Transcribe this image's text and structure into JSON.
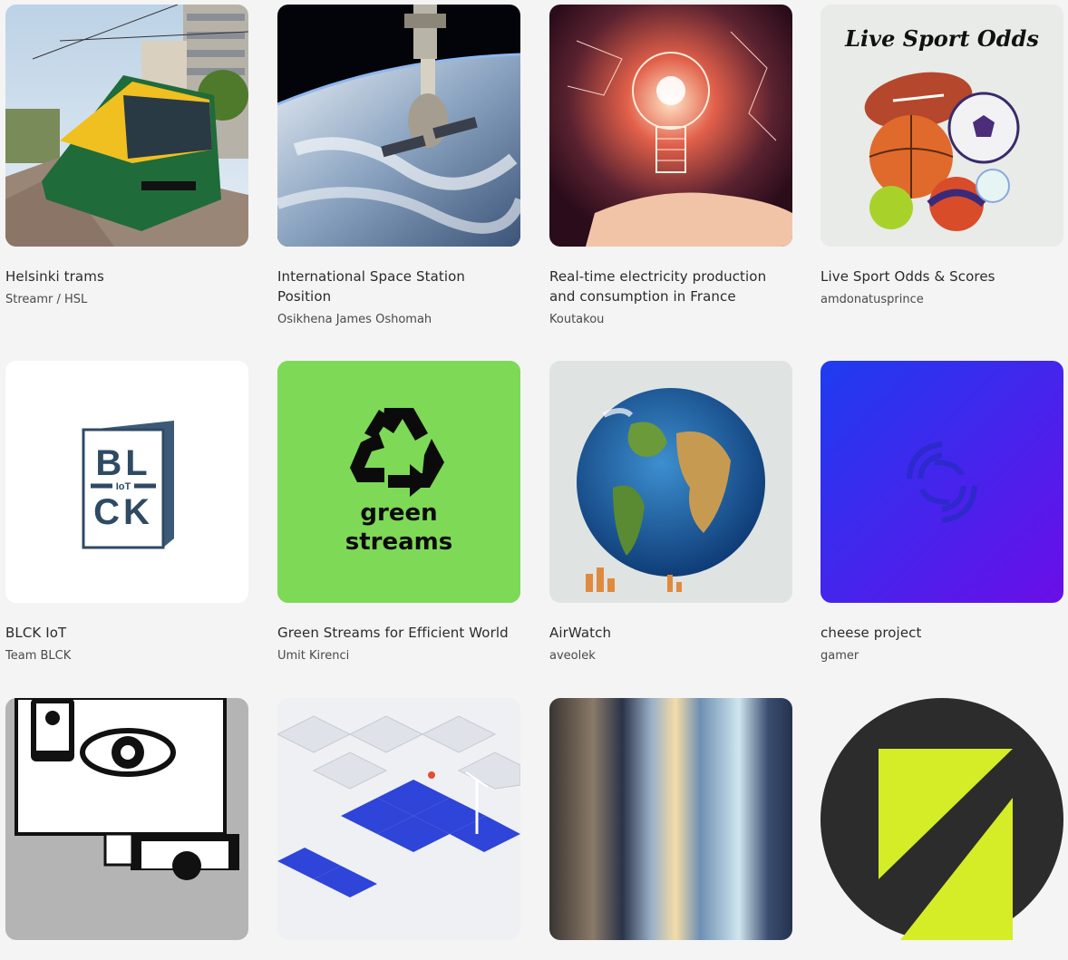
{
  "streams": [
    {
      "title": "Helsinki trams",
      "author": "Streamr / HSL",
      "thumb_icon": "tram-photo"
    },
    {
      "title": "International Space Station Position",
      "author": "Osikhena James Oshomah",
      "thumb_icon": "space-station-photo"
    },
    {
      "title": "Real-time electricity production and consumption in France",
      "author": "Koutakou",
      "thumb_icon": "lightbulb-hand-image"
    },
    {
      "title": "Live Sport Odds & Scores",
      "author": "amdonatusprince",
      "thumb_icon": "sport-balls-image",
      "thumb_text": "Live Sport Odds"
    },
    {
      "title": "BLCK IoT",
      "author": "Team BLCK",
      "thumb_icon": "blck-iot-logo",
      "thumb_text": {
        "bl": "BL",
        "iot": "IoT",
        "ck": "CK"
      }
    },
    {
      "title": "Green Streams for Efficient World",
      "author": "Umit Kirenci",
      "thumb_icon": "recycle-logo",
      "thumb_text": {
        "line1": "green",
        "line2": "streams"
      }
    },
    {
      "title": "AirWatch",
      "author": "aveolek",
      "thumb_icon": "earth-globe-image"
    },
    {
      "title": "cheese project",
      "author": "gamer",
      "thumb_icon": "streamr-logo"
    },
    {
      "title": "",
      "author": "",
      "thumb_icon": "eye-devices-image"
    },
    {
      "title": "",
      "author": "",
      "thumb_icon": "isometric-city-image"
    },
    {
      "title": "",
      "author": "",
      "thumb_icon": "blurred-stripes-image"
    },
    {
      "title": "",
      "author": "",
      "thumb_icon": "chevron-logo"
    }
  ],
  "colors": {
    "background": "#f4f4f4",
    "green_streams": "#7ed957",
    "cheese_gradient_start": "#1e3cf0",
    "cheese_gradient_end": "#6a0ee8",
    "blck_navy": "#2f4a63",
    "chevron_lime": "#d4ed26",
    "chevron_dark": "#2c2c2c"
  }
}
